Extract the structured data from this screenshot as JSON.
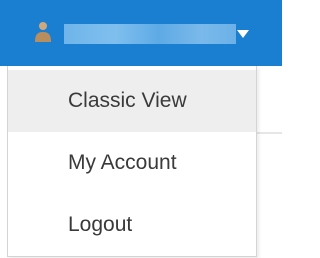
{
  "header": {
    "user_name": "",
    "user_icon": "user-icon",
    "caret_icon": "caret-down-icon"
  },
  "menu": {
    "items": [
      {
        "label": "Classic View",
        "active": true
      },
      {
        "label": "My Account",
        "active": false
      },
      {
        "label": "Logout",
        "active": false
      }
    ]
  },
  "colors": {
    "header_bg": "#1a7fd1",
    "menu_active_bg": "#eeeeee",
    "menu_text": "#3a3a3a",
    "menu_border": "#d4d4d4"
  }
}
